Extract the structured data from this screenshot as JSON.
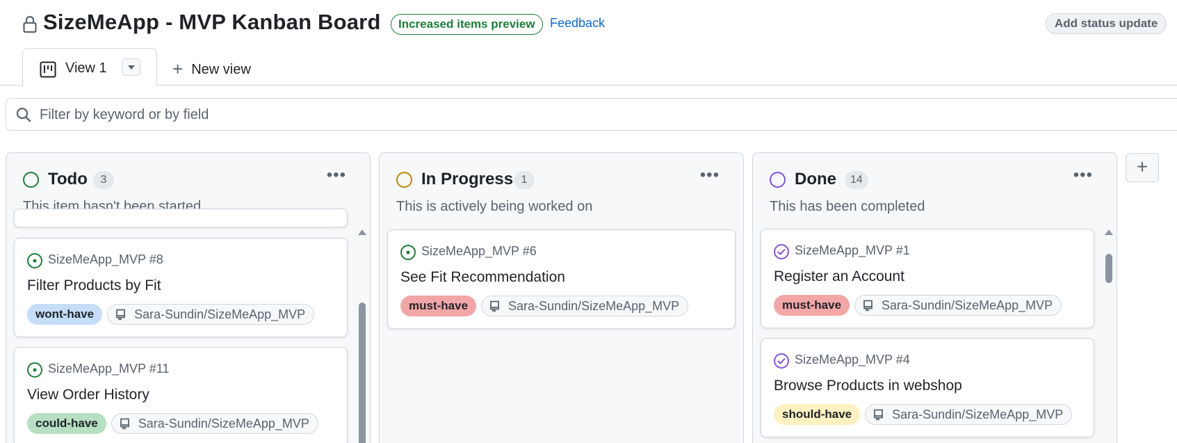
{
  "header": {
    "title": "SizeMeApp - MVP Kanban Board",
    "preview_badge": "Increased items preview",
    "feedback_link": "Feedback",
    "status_button": "Add status update"
  },
  "tabs": {
    "active_label": "View 1",
    "new_view_label": "New view"
  },
  "filter": {
    "placeholder": "Filter by keyword or by field"
  },
  "colors": {
    "todo": "#1a7f37",
    "in_progress": "#bf8700",
    "done": "#8250df",
    "must_have": "#f3a6a6",
    "should_have": "#fff1c2",
    "could_have": "#b7dfc2",
    "wont_have": "#c6ddf8"
  },
  "columns": [
    {
      "title": "Todo",
      "count": "3",
      "description": "This item hasn't been started",
      "cards": [
        {
          "ref": "SizeMeApp_MVP #8",
          "title": "Filter Products by Fit",
          "label": "wont-have",
          "repo": "Sara-Sundin/SizeMeApp_MVP"
        },
        {
          "ref": "SizeMeApp_MVP #11",
          "title": "View Order History",
          "label": "could-have",
          "repo": "Sara-Sundin/SizeMeApp_MVP"
        }
      ]
    },
    {
      "title": "In Progress",
      "count": "1",
      "description": "This is actively being worked on",
      "cards": [
        {
          "ref": "SizeMeApp_MVP #6",
          "title": "See Fit Recommendation",
          "label": "must-have",
          "repo": "Sara-Sundin/SizeMeApp_MVP"
        }
      ]
    },
    {
      "title": "Done",
      "count": "14",
      "description": "This has been completed",
      "cards": [
        {
          "ref": "SizeMeApp_MVP #1",
          "title": "Register an Account",
          "label": "must-have",
          "repo": "Sara-Sundin/SizeMeApp_MVP"
        },
        {
          "ref": "SizeMeApp_MVP #4",
          "title": "Browse Products in webshop",
          "label": "should-have",
          "repo": "Sara-Sundin/SizeMeApp_MVP"
        }
      ]
    }
  ]
}
